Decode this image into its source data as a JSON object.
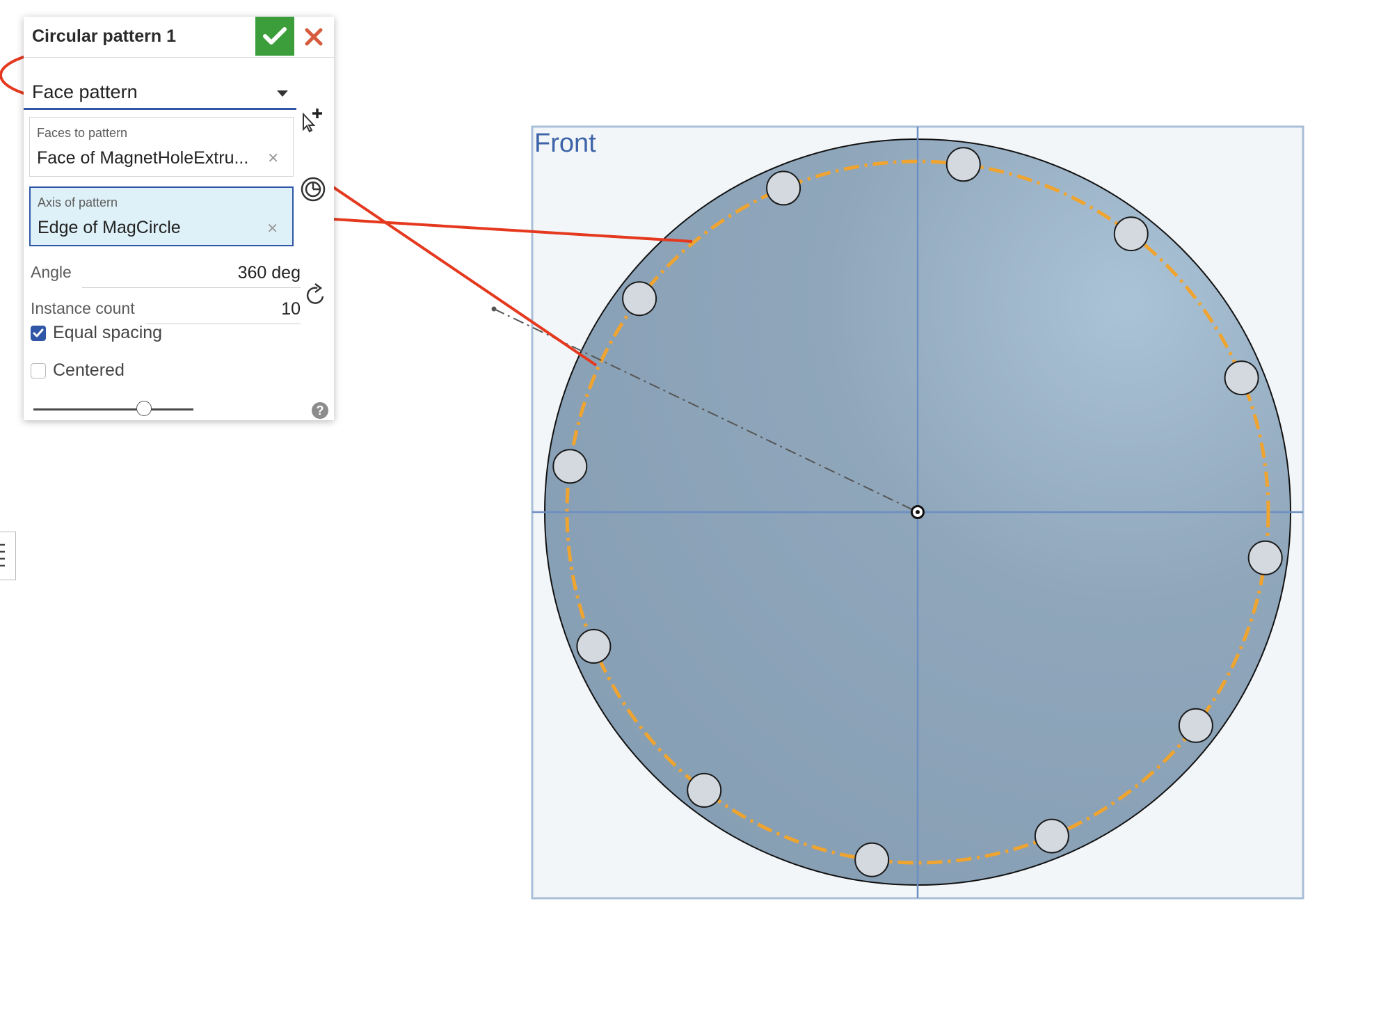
{
  "dialog": {
    "title": "Circular pattern 1",
    "pattern_type": "Face pattern",
    "faces_to_pattern": {
      "label": "Faces to pattern",
      "value": "Face of MagnetHoleExtru..."
    },
    "axis_of_pattern": {
      "label": "Axis of pattern",
      "value": "Edge of MagCircle"
    },
    "angle": {
      "label": "Angle",
      "value": "360 deg"
    },
    "instance_count": {
      "label": "Instance count",
      "value": "10"
    },
    "equal_spacing": {
      "label": "Equal spacing",
      "checked": true
    },
    "centered": {
      "label": "Centered",
      "checked": false
    },
    "preview_slider": {
      "level": 0.69
    }
  },
  "viewport": {
    "plane_label": "Front",
    "hole_count": 12
  },
  "colors": {
    "accept_green": "#3c9e3a",
    "cancel_red": "#d65b3c",
    "selection_blue": "#2f56a7",
    "annotation_red": "#e5391f",
    "path_orange": "#f0a430",
    "part_blue": "#8ea6bb"
  },
  "icons": [
    "check-icon",
    "close-icon",
    "dropdown-caret-icon",
    "add-selection-icon",
    "pie-axis-icon",
    "reverse-direction-icon",
    "help-icon",
    "list-icon"
  ]
}
